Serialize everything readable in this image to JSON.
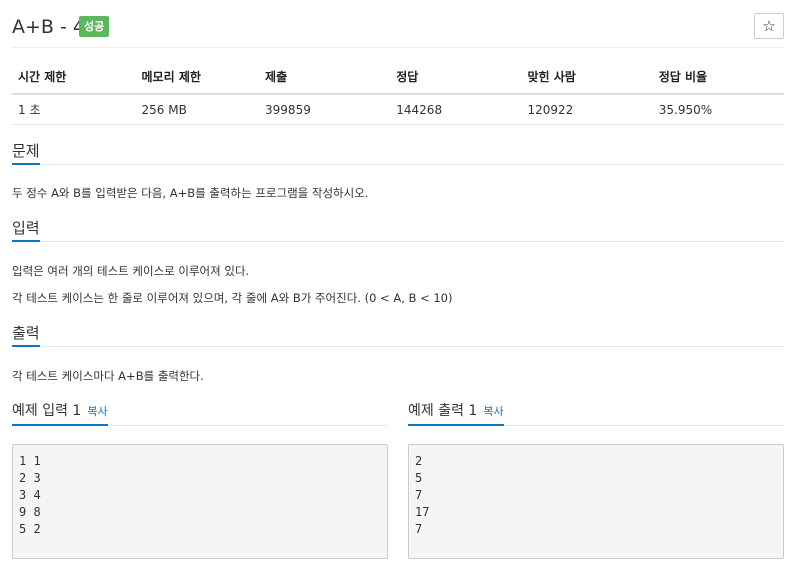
{
  "problem": {
    "title": "A+B - 4",
    "badge": "성공",
    "star_icon": "☆"
  },
  "info_table": {
    "headers": [
      "시간 제한",
      "메모리 제한",
      "제출",
      "정답",
      "맞힌 사람",
      "정답 비율"
    ],
    "values": [
      "1 초",
      "256 MB",
      "399859",
      "144268",
      "120922",
      "35.950%"
    ]
  },
  "sections": {
    "problem_title": "문제",
    "problem_text": "두 정수 A와 B를 입력받은 다음, A+B를 출력하는 프로그램을 작성하시오.",
    "input_title": "입력",
    "input_text_1": "입력은 여러 개의 테스트 케이스로 이루어져 있다.",
    "input_text_2": "각 테스트 케이스는 한 줄로 이루어져 있으며, 각 줄에 A와 B가 주어진다. (0 < A, B < 10)",
    "output_title": "출력",
    "output_text": "각 테스트 케이스마다 A+B를 출력한다."
  },
  "samples": {
    "input_title": "예제 입력 1",
    "output_title": "예제 출력 1",
    "copy_label": "복사",
    "input_data": "1 1\n2 3\n3 4\n9 8\n5 2",
    "output_data": "2\n5\n7\n17\n7"
  },
  "colors": {
    "badge": "#5cb85c",
    "accent": "#0e76bd"
  }
}
